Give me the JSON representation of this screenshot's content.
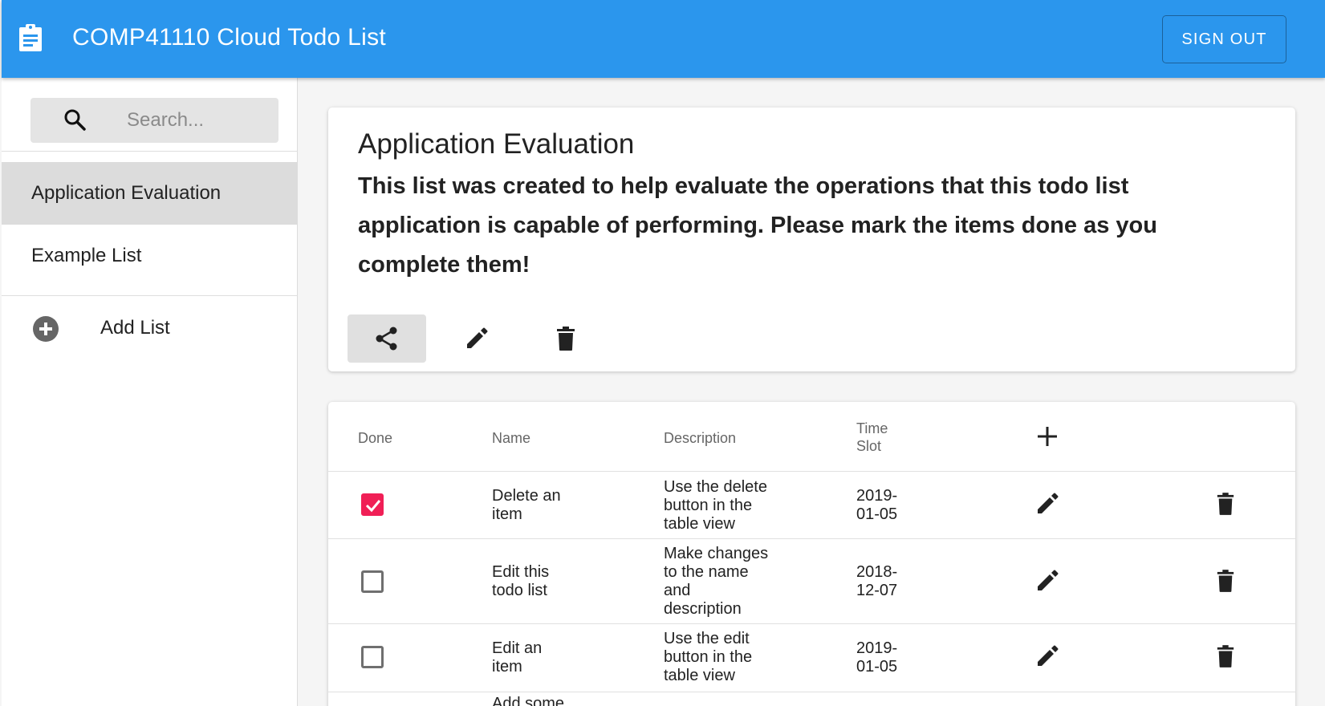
{
  "app": {
    "title": "COMP41110 Cloud Todo List",
    "logo_icon": "clipboard-icon",
    "signout_label": "SIGN OUT",
    "accent": "#2b96ed"
  },
  "sidebar": {
    "search_placeholder": "Search...",
    "lists": [
      {
        "label": "Application Evaluation",
        "active": true
      },
      {
        "label": "Example List",
        "active": false
      }
    ],
    "add_list_label": "Add List"
  },
  "list": {
    "name": "Application Evaluation",
    "description": "This list was created to help evaluate the operations that this todo list application is capable of performing. Please mark the items done as you complete them!",
    "actions": [
      "share-icon",
      "edit-icon",
      "delete-icon"
    ]
  },
  "table": {
    "headers": {
      "done": "Done",
      "name": "Name",
      "description": "Description",
      "time_line1": "Time",
      "time_line2": "Slot"
    },
    "add_icon": "plus-icon",
    "rows": [
      {
        "done": true,
        "name_l1": "Delete an",
        "name_l2": "item",
        "desc_lines": [
          "Use the delete",
          "button in the",
          "table view"
        ],
        "time_l1": "2019-",
        "time_l2": "01-05"
      },
      {
        "done": false,
        "name_l1": "Edit this",
        "name_l2": "todo list",
        "desc_lines": [
          "Make changes",
          "to the name",
          "and",
          "description"
        ],
        "time_l1": "2018-",
        "time_l2": "12-07"
      },
      {
        "done": false,
        "name_l1": "Edit an",
        "name_l2": "item",
        "desc_lines": [
          "Use the edit",
          "button in the",
          "table view"
        ],
        "time_l1": "2019-",
        "time_l2": "01-05"
      }
    ],
    "partial_row_name": "Add some",
    "checked_color": "#f01f56"
  }
}
